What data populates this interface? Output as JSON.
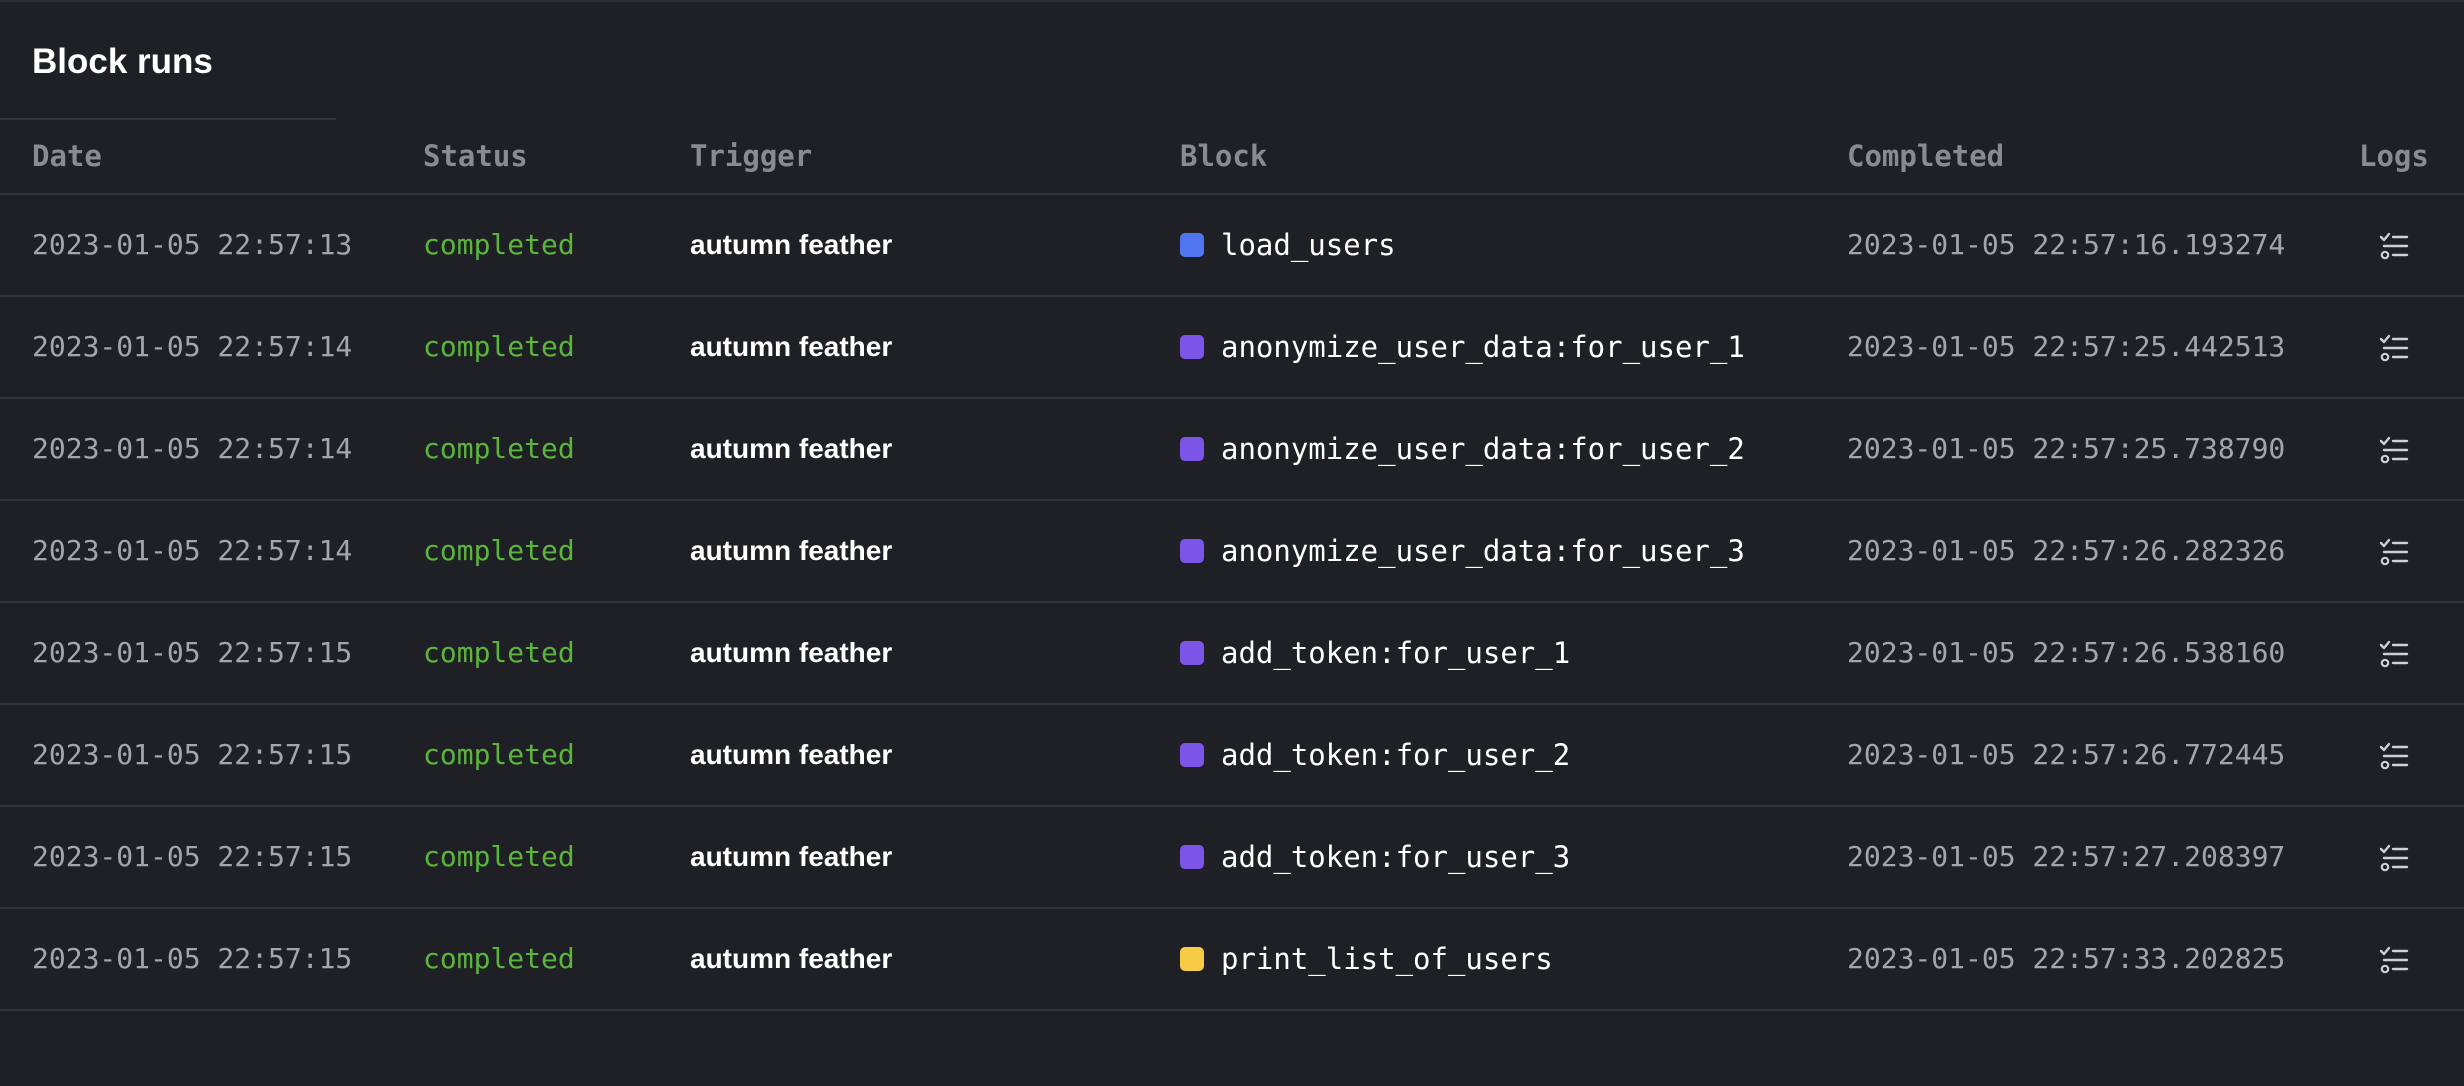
{
  "title": "Block runs",
  "colors": {
    "background": "#1f2025",
    "divider": "#34353b",
    "status_completed": "#5bb53b",
    "block_blue": "#4f75f0",
    "block_purple": "#7b55e8",
    "block_yellow": "#f7cc45"
  },
  "columns": {
    "date": "Date",
    "status": "Status",
    "trigger": "Trigger",
    "block": "Block",
    "completed": "Completed",
    "logs": "Logs"
  },
  "rows": [
    {
      "date": "2023-01-05 22:57:13",
      "status": "completed",
      "trigger": "autumn feather",
      "block": "load_users",
      "block_color": "#4f75f0",
      "completed": "2023-01-05 22:57:16.193274",
      "logs_icon": "logs-list-icon"
    },
    {
      "date": "2023-01-05 22:57:14",
      "status": "completed",
      "trigger": "autumn feather",
      "block": "anonymize_user_data:for_user_1",
      "block_color": "#7b55e8",
      "completed": "2023-01-05 22:57:25.442513",
      "logs_icon": "logs-list-icon"
    },
    {
      "date": "2023-01-05 22:57:14",
      "status": "completed",
      "trigger": "autumn feather",
      "block": "anonymize_user_data:for_user_2",
      "block_color": "#7b55e8",
      "completed": "2023-01-05 22:57:25.738790",
      "logs_icon": "logs-list-icon"
    },
    {
      "date": "2023-01-05 22:57:14",
      "status": "completed",
      "trigger": "autumn feather",
      "block": "anonymize_user_data:for_user_3",
      "block_color": "#7b55e8",
      "completed": "2023-01-05 22:57:26.282326",
      "logs_icon": "logs-list-icon"
    },
    {
      "date": "2023-01-05 22:57:15",
      "status": "completed",
      "trigger": "autumn feather",
      "block": "add_token:for_user_1",
      "block_color": "#7b55e8",
      "completed": "2023-01-05 22:57:26.538160",
      "logs_icon": "logs-list-icon"
    },
    {
      "date": "2023-01-05 22:57:15",
      "status": "completed",
      "trigger": "autumn feather",
      "block": "add_token:for_user_2",
      "block_color": "#7b55e8",
      "completed": "2023-01-05 22:57:26.772445",
      "logs_icon": "logs-list-icon"
    },
    {
      "date": "2023-01-05 22:57:15",
      "status": "completed",
      "trigger": "autumn feather",
      "block": "add_token:for_user_3",
      "block_color": "#7b55e8",
      "completed": "2023-01-05 22:57:27.208397",
      "logs_icon": "logs-list-icon"
    },
    {
      "date": "2023-01-05 22:57:15",
      "status": "completed",
      "trigger": "autumn feather",
      "block": "print_list_of_users",
      "block_color": "#f7cc45",
      "completed": "2023-01-05 22:57:33.202825",
      "logs_icon": "logs-list-icon"
    }
  ]
}
